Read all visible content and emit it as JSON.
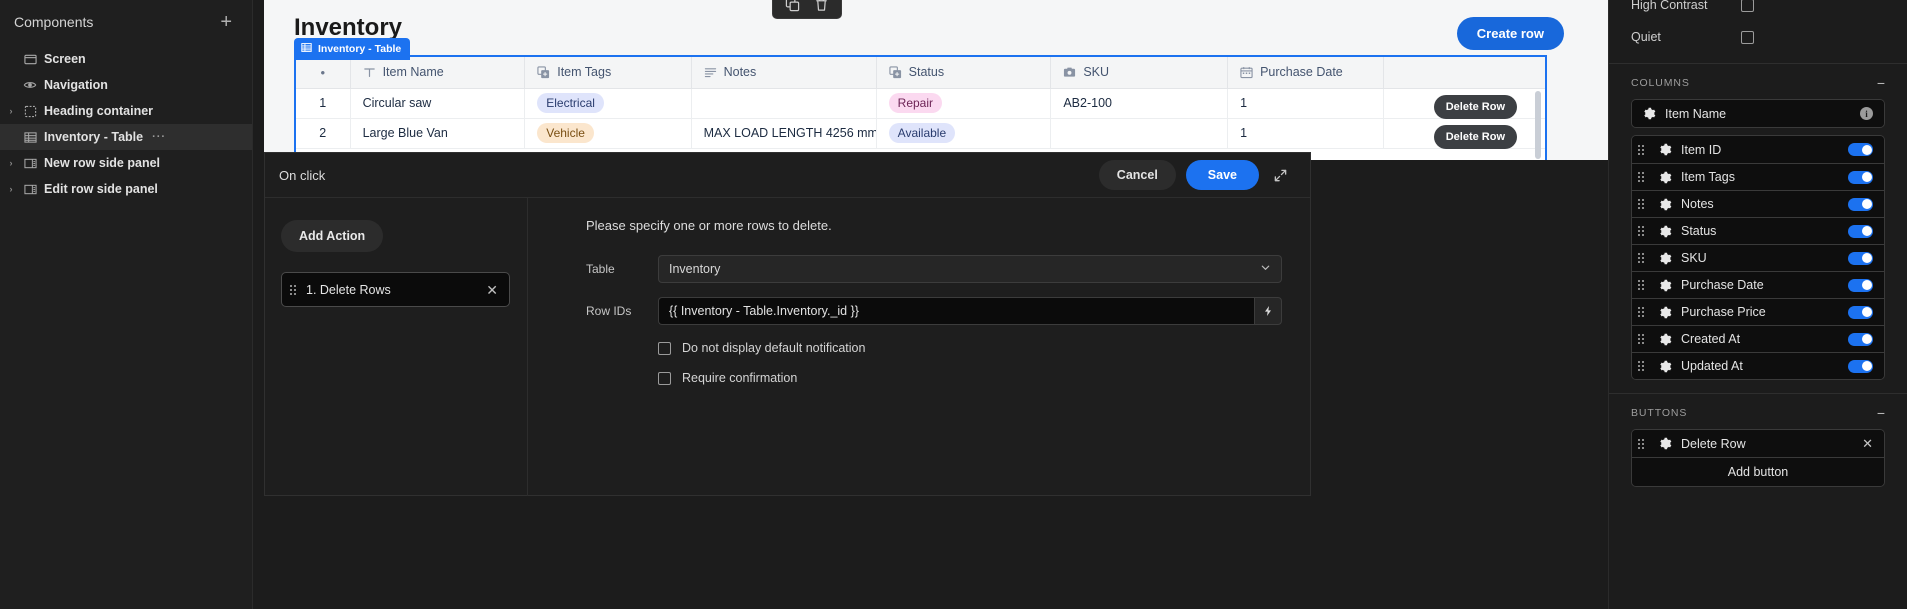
{
  "left_sidebar": {
    "title": "Components",
    "add_icon": "plus-icon",
    "items": [
      {
        "label": "Screen",
        "icon": "screen-icon",
        "expandable": false,
        "selected": false
      },
      {
        "label": "Navigation",
        "icon": "eye-icon",
        "expandable": false,
        "selected": false
      },
      {
        "label": "Heading container",
        "icon": "dashed-container-icon",
        "expandable": true,
        "selected": false
      },
      {
        "label": "Inventory - Table",
        "icon": "table-icon",
        "expandable": false,
        "selected": true,
        "menu": "···"
      },
      {
        "label": "New row side panel",
        "icon": "side-panel-icon",
        "expandable": true,
        "selected": false
      },
      {
        "label": "Edit row side panel",
        "icon": "side-panel-icon",
        "expandable": true,
        "selected": false
      }
    ]
  },
  "canvas": {
    "page_title": "Inventory",
    "create_row_label": "Create row",
    "selection_badge": "Inventory - Table",
    "float_toolbar": [
      {
        "icon": "duplicate-icon"
      },
      {
        "icon": "trash-icon"
      }
    ],
    "table": {
      "columns": [
        {
          "label": "",
          "icon": "dot-icon"
        },
        {
          "label": "Item Name",
          "icon": "text-type-icon"
        },
        {
          "label": "Item Tags",
          "icon": "multiselect-icon"
        },
        {
          "label": "Notes",
          "icon": "longtext-icon"
        },
        {
          "label": "Status",
          "icon": "multiselect-icon"
        },
        {
          "label": "SKU",
          "icon": "attachment-icon"
        },
        {
          "label": "Purchase Date",
          "icon": "calendar-icon"
        }
      ],
      "rows": [
        {
          "index": "1",
          "item_name": "Circular saw",
          "item_tags": "Electrical",
          "item_tags_color": "blue",
          "notes": "",
          "status": "Repair",
          "status_color": "pink",
          "sku": "AB2-100",
          "purchase_date": "1",
          "button": "Delete Row"
        },
        {
          "index": "2",
          "item_name": "Large Blue Van",
          "item_tags": "Vehicle",
          "item_tags_color": "orange",
          "notes": "MAX LOAD LENGTH 4256 mm",
          "status": "Available",
          "status_color": "periwinkle",
          "sku": "",
          "purchase_date": "1",
          "button": "Delete Row"
        }
      ]
    }
  },
  "modal": {
    "title": "On click",
    "cancel_label": "Cancel",
    "save_label": "Save",
    "expand_icon": "expand-icon",
    "add_action_label": "Add Action",
    "actions": [
      {
        "label": "1. Delete Rows",
        "close_icon": "close-icon",
        "drag_icon": "drag-handle-icon"
      }
    ],
    "config": {
      "description": "Please specify one or more rows to delete.",
      "table_label": "Table",
      "table_value": "Inventory",
      "table_chevron": "chevron-down-icon",
      "row_ids_label": "Row IDs",
      "row_ids_value": "{{ Inventory - Table.Inventory._id }}",
      "binding_icon": "lightning-icon",
      "checkboxes": [
        {
          "label": "Do not display default notification",
          "checked": false
        },
        {
          "label": "Require confirmation",
          "checked": false
        }
      ]
    }
  },
  "right_sidebar": {
    "top_props": [
      {
        "label": "High Contrast",
        "checked": false
      },
      {
        "label": "Quiet",
        "checked": false
      }
    ],
    "columns_section": {
      "title": "COLUMNS",
      "collapse_icon": "minus-icon",
      "primary": {
        "label": "Item Name",
        "icon": "gear-icon",
        "info_icon": "info-icon"
      },
      "items": [
        {
          "label": "Item ID",
          "enabled": true
        },
        {
          "label": "Item Tags",
          "enabled": true
        },
        {
          "label": "Notes",
          "enabled": true
        },
        {
          "label": "Status",
          "enabled": true
        },
        {
          "label": "SKU",
          "enabled": true
        },
        {
          "label": "Purchase Date",
          "enabled": true
        },
        {
          "label": "Purchase Price",
          "enabled": true
        },
        {
          "label": "Created At",
          "enabled": true
        },
        {
          "label": "Updated At",
          "enabled": true
        }
      ]
    },
    "buttons_section": {
      "title": "BUTTONS",
      "collapse_icon": "minus-icon",
      "items": [
        {
          "label": "Delete Row",
          "close_icon": "close-icon"
        }
      ],
      "add_label": "Add button"
    }
  },
  "colors": {
    "accent_blue": "#1c72f0",
    "create_row_blue": "#1868db",
    "canvas_bg": "#f5f6f7",
    "panel_bg": "#1c1c1c"
  }
}
